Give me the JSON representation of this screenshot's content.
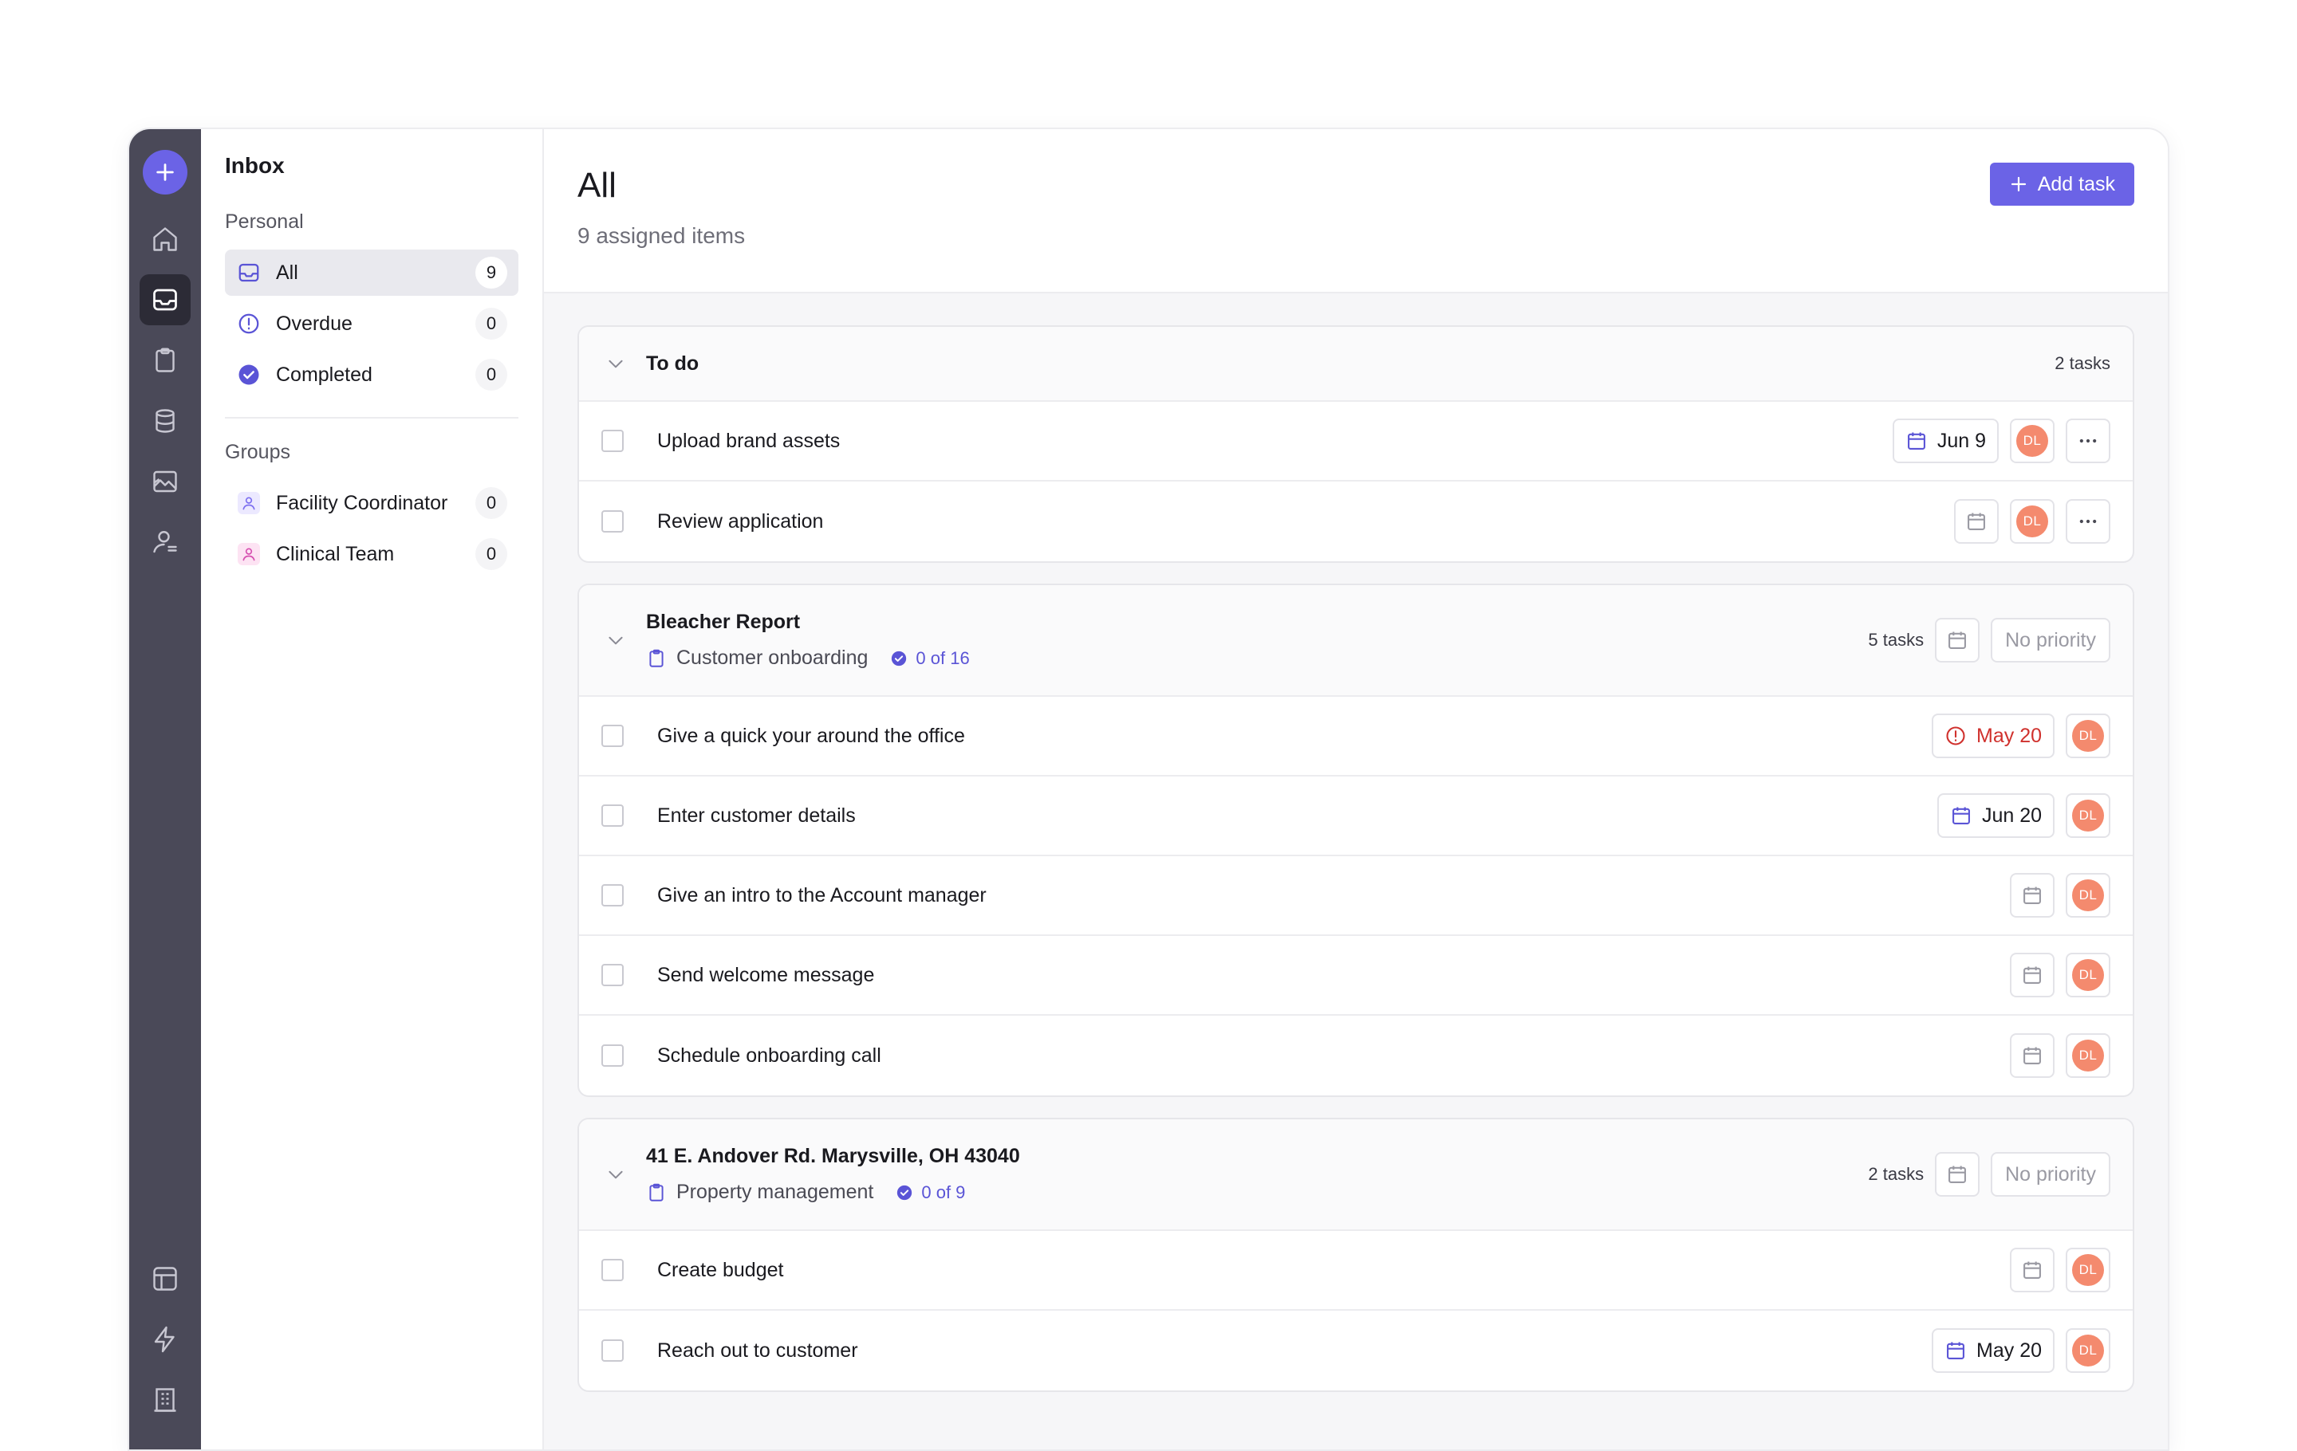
{
  "sidebar": {
    "title": "Inbox",
    "personal_label": "Personal",
    "items": [
      {
        "label": "All",
        "count": "9"
      },
      {
        "label": "Overdue",
        "count": "0"
      },
      {
        "label": "Completed",
        "count": "0"
      }
    ],
    "groups_label": "Groups",
    "groups": [
      {
        "label": "Facility Coordinator",
        "count": "0"
      },
      {
        "label": "Clinical Team",
        "count": "0"
      }
    ]
  },
  "header": {
    "title": "All",
    "subtitle": "9 assigned items",
    "add_task_label": "Add task"
  },
  "sections": [
    {
      "title": "To do",
      "task_count": "2 tasks",
      "tasks": [
        {
          "label": "Upload brand assets",
          "date": "Jun 9",
          "assignee": "DL"
        },
        {
          "label": "Review application",
          "date": "",
          "assignee": "DL"
        }
      ]
    },
    {
      "title": "Bleacher Report",
      "subtitle": "Customer onboarding",
      "progress": "0 of 16",
      "task_count": "5 tasks",
      "priority": "No priority",
      "tasks": [
        {
          "label": "Give a quick your around the office",
          "date": "May 20",
          "overdue": true,
          "assignee": "DL"
        },
        {
          "label": "Enter customer details",
          "date": "Jun 20",
          "assignee": "DL"
        },
        {
          "label": "Give an intro to the Account manager",
          "date": "",
          "assignee": "DL"
        },
        {
          "label": "Send welcome message",
          "date": "",
          "assignee": "DL"
        },
        {
          "label": "Schedule onboarding call",
          "date": "",
          "assignee": "DL"
        }
      ]
    },
    {
      "title": "41 E. Andover Rd. Marysville, OH 43040",
      "subtitle": "Property management",
      "progress": "0 of 9",
      "task_count": "2 tasks",
      "priority": "No priority",
      "tasks": [
        {
          "label": "Create budget",
          "date": "",
          "assignee": "DL"
        },
        {
          "label": "Reach out to customer",
          "date": "May 20",
          "assignee": "DL"
        }
      ]
    }
  ],
  "colors": {
    "accent": "#6b63e6",
    "rail": "#4a4958",
    "avatar": "#f48a6e",
    "overdue": "#d0312d"
  },
  "icons": {
    "rail": [
      "plus-icon",
      "home-icon",
      "inbox-icon",
      "clipboard-icon",
      "database-icon",
      "chart-icon",
      "user-icon",
      "layout-icon",
      "bolt-icon",
      "building-icon"
    ]
  }
}
